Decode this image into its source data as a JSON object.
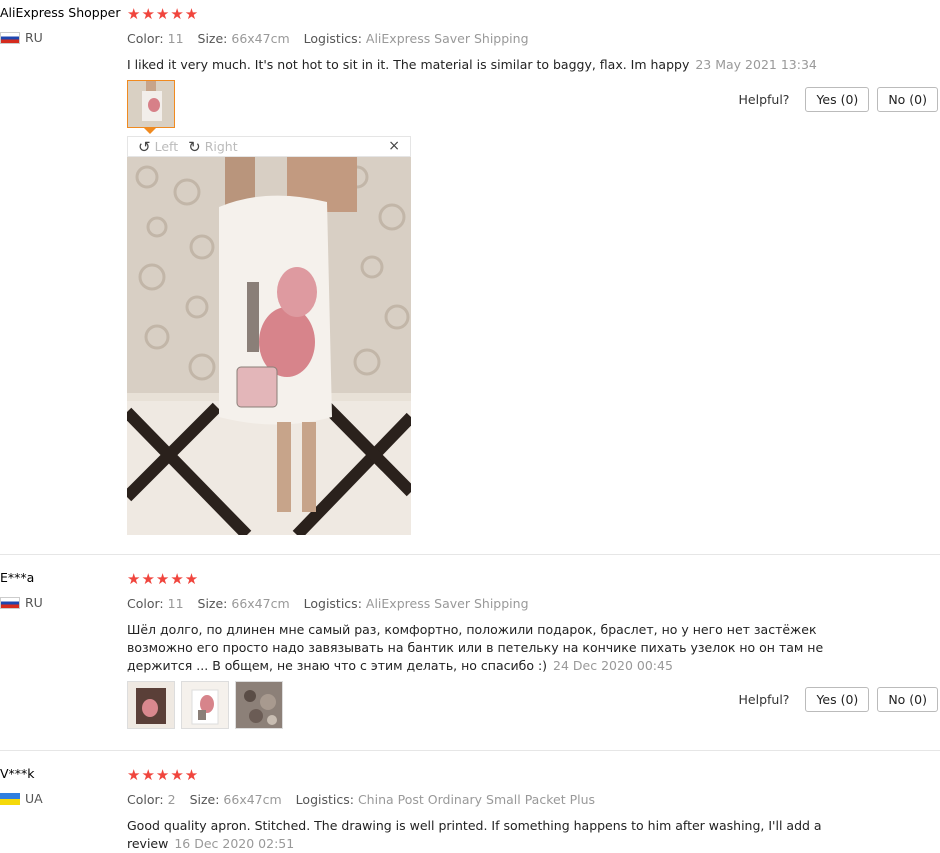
{
  "reviews": [
    {
      "author": "AliExpress Shopper",
      "country": "RU",
      "stars": "★★★★★",
      "color_label": "Color:",
      "color_value": "11",
      "size_label": "Size:",
      "size_value": "66x47cm",
      "logistics_label": "Logistics:",
      "logistics_value": "AliExpress Saver Shipping",
      "text": "I liked it very much. It's not hot to sit in it. The material is similar to baggy, flax. Im happy",
      "date": "23 May 2021 13:34",
      "helpful_label": "Helpful?",
      "yes_label": "Yes (0)",
      "no_label": "No (0)"
    },
    {
      "author": "E***a",
      "country": "RU",
      "stars": "★★★★★",
      "color_label": "Color:",
      "color_value": "11",
      "size_label": "Size:",
      "size_value": "66x47cm",
      "logistics_label": "Logistics:",
      "logistics_value": "AliExpress Saver Shipping",
      "text": "Шёл долго, по длинен мне самый раз, комфортно, положили подарок, браслет, но у него нет застёжек возможно его просто надо завязывать на бантик или в петельку на кончике пихать узелок но он там не держится ... В общем, не знаю что с этим делать, но спасибо :)",
      "date": "24 Dec 2020 00:45",
      "helpful_label": "Helpful?",
      "yes_label": "Yes (0)",
      "no_label": "No (0)"
    },
    {
      "author": "V***k",
      "country": "UA",
      "stars": "★★★★★",
      "color_label": "Color:",
      "color_value": "2",
      "size_label": "Size:",
      "size_value": "66x47cm",
      "logistics_label": "Logistics:",
      "logistics_value": "China Post Ordinary Small Packet Plus",
      "text": "Good quality apron. Stitched. The drawing is well printed. If something happens to him after washing, I'll add a review",
      "date": "16 Dec 2020 02:51"
    }
  ],
  "viewer": {
    "left_label": "Left",
    "right_label": "Right",
    "close": "×"
  },
  "colors": {
    "star": "#f0453d",
    "active_thumb_border": "#f08a20"
  }
}
